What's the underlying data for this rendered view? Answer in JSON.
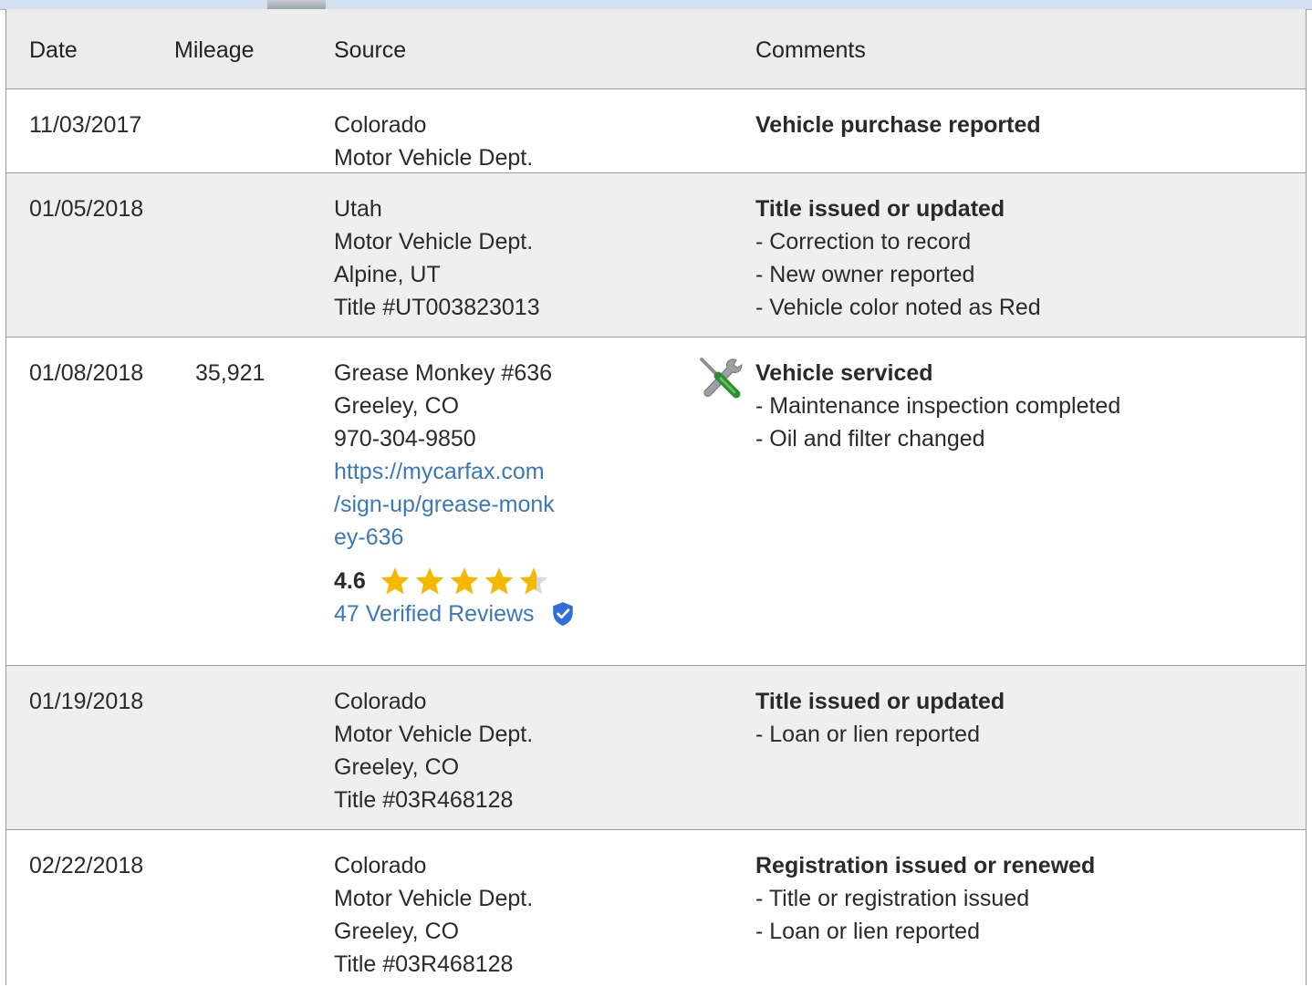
{
  "header": {
    "date": "Date",
    "mileage": "Mileage",
    "source": "Source",
    "comments": "Comments"
  },
  "rows": [
    {
      "date": "11/03/2017",
      "mileage": "",
      "source": [
        "Colorado",
        "Motor Vehicle Dept."
      ],
      "comment_title": "Vehicle purchase reported",
      "comment_lines": []
    },
    {
      "date": "01/05/2018",
      "mileage": "",
      "source": [
        "Utah",
        "Motor Vehicle Dept.",
        "Alpine, UT",
        "Title #UT003823013"
      ],
      "comment_title": "Title issued or updated",
      "comment_lines": [
        "- Correction to record",
        "- New owner reported",
        "- Vehicle color noted as Red"
      ]
    },
    {
      "date": "01/08/2018",
      "mileage": "35,921",
      "source": [
        "Grease Monkey #636",
        "Greeley, CO",
        "970-304-9850"
      ],
      "source_link": [
        "https://mycarfax.com",
        "/sign-up/grease-monk",
        "ey-636"
      ],
      "rating": "4.6",
      "rating_value": 4.6,
      "rating_max": 5,
      "reviews": "47 Verified Reviews",
      "icon": "service-wrench-screwdriver-icon",
      "comment_title": "Vehicle serviced",
      "comment_lines": [
        "- Maintenance inspection completed",
        "- Oil and filter changed"
      ]
    },
    {
      "date": "01/19/2018",
      "mileage": "",
      "source": [
        "Colorado",
        "Motor Vehicle Dept.",
        "Greeley, CO",
        "Title #03R468128"
      ],
      "comment_title": "Title issued or updated",
      "comment_lines": [
        "- Loan or lien reported"
      ]
    },
    {
      "date": "02/22/2018",
      "mileage": "",
      "source": [
        "Colorado",
        "Motor Vehicle Dept.",
        "Greeley, CO",
        "Title #03R468128"
      ],
      "comment_title": "Registration issued or renewed",
      "comment_lines": [
        "- Title or registration issued",
        "- Loan or lien reported"
      ]
    }
  ],
  "colors": {
    "header_bg": "#ececec",
    "alt_row_bg": "#efefef",
    "link": "#3b78b9",
    "star": "#f5b800",
    "verified_badge": "#2f6fd6"
  }
}
